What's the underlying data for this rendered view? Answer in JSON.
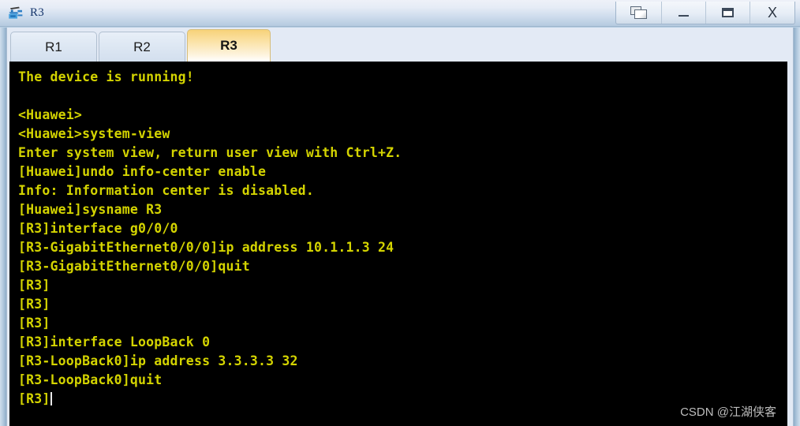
{
  "window": {
    "title": "R3",
    "app_icon": "router-icon",
    "controls": [
      {
        "name": "cascade-windows-button",
        "icon": "cascade-windows-icon",
        "label": ""
      },
      {
        "name": "minimize-button",
        "icon": "minimize-icon",
        "label": ""
      },
      {
        "name": "maximize-button",
        "icon": "maximize-icon",
        "label": ""
      },
      {
        "name": "close-button",
        "icon": "close-icon",
        "label": "X"
      }
    ],
    "colors": {
      "titlebar_top": "#eef1f8",
      "titlebar_bottom": "#b5cadf",
      "frame": "#aec6dc",
      "terminal_bg": "#000000",
      "terminal_fg": "#d4d400",
      "active_tab_accent": "#f7d27a",
      "title_text": "#15356b"
    }
  },
  "tabs": [
    {
      "label": "R1",
      "active": false
    },
    {
      "label": "R2",
      "active": false
    },
    {
      "label": "R3",
      "active": true
    }
  ],
  "terminal": {
    "cursor_line_index": 17,
    "lines": [
      "The device is running!",
      "",
      "<Huawei>",
      "<Huawei>system-view",
      "Enter system view, return user view with Ctrl+Z.",
      "[Huawei]undo info-center enable",
      "Info: Information center is disabled.",
      "[Huawei]sysname R3",
      "[R3]interface g0/0/0",
      "[R3-GigabitEthernet0/0/0]ip address 10.1.1.3 24",
      "[R3-GigabitEthernet0/0/0]quit",
      "[R3]",
      "[R3]",
      "[R3]",
      "[R3]interface LoopBack 0",
      "[R3-LoopBack0]ip address 3.3.3.3 32",
      "[R3-LoopBack0]quit",
      "[R3]"
    ]
  },
  "watermark": {
    "text": "CSDN @江湖侠客"
  }
}
